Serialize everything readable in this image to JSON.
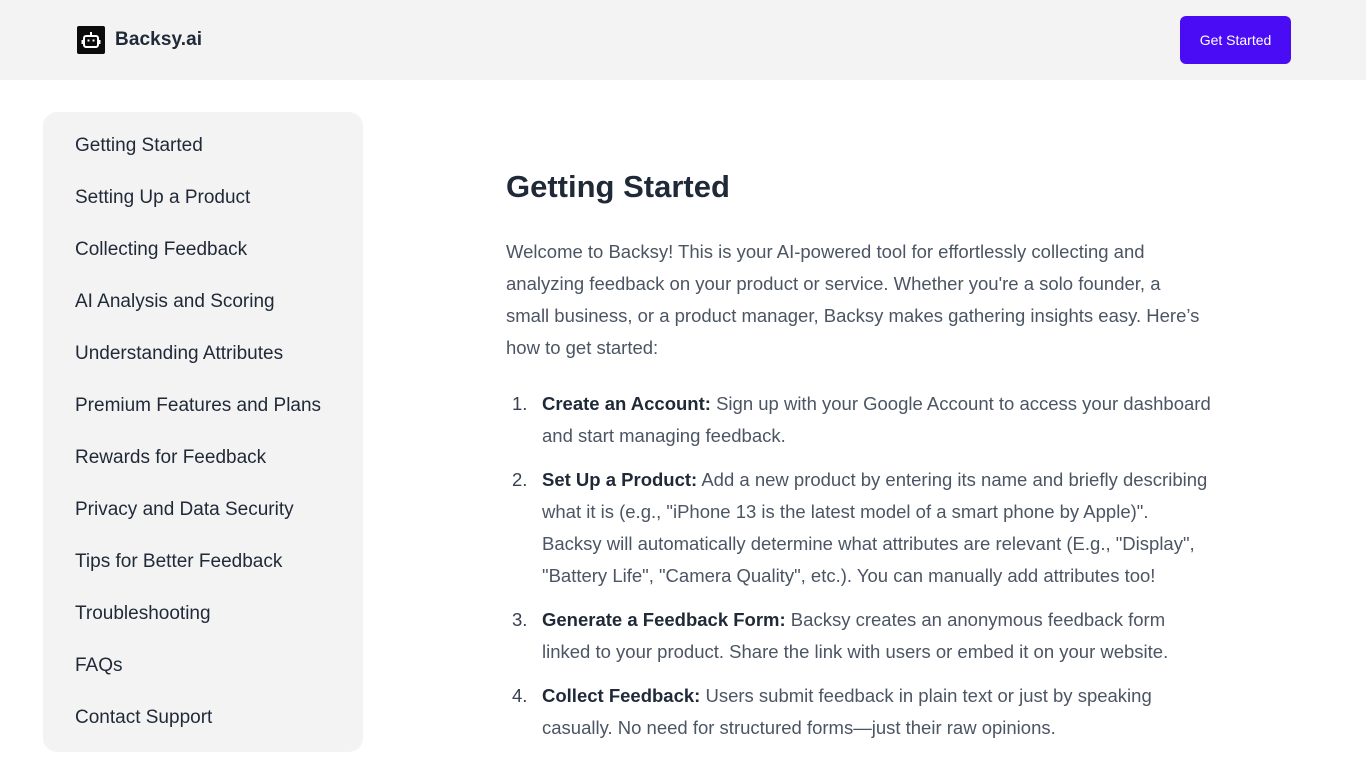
{
  "header": {
    "brand": "Backsy.ai",
    "logo_icon": "robot-icon",
    "cta_label": "Get Started"
  },
  "sidebar": {
    "items": [
      {
        "label": "Getting Started"
      },
      {
        "label": "Setting Up a Product"
      },
      {
        "label": "Collecting Feedback"
      },
      {
        "label": "AI Analysis and Scoring"
      },
      {
        "label": "Understanding Attributes"
      },
      {
        "label": "Premium Features and Plans"
      },
      {
        "label": "Rewards for Feedback"
      },
      {
        "label": "Privacy and Data Security"
      },
      {
        "label": "Tips for Better Feedback"
      },
      {
        "label": "Troubleshooting"
      },
      {
        "label": "FAQs"
      },
      {
        "label": "Contact Support"
      }
    ]
  },
  "main": {
    "title": "Getting Started",
    "intro": "Welcome to Backsy! This is your AI-powered tool for effortlessly collecting and analyzing feedback on your product or service. Whether you're a solo founder, a small business, or a product manager, Backsy makes gathering insights easy. Here’s how to get started:",
    "steps": [
      {
        "number": "1.",
        "title": "Create an Account:",
        "text": " Sign up with your Google Account to access your dashboard and start managing feedback."
      },
      {
        "number": "2.",
        "title": "Set Up a Product:",
        "text": " Add a new product by entering its name and briefly describing what it is (e.g., \"iPhone 13 is the latest model of a smart phone by Apple)\". Backsy will automatically determine what attributes are relevant (E.g., \"Display\", \"Battery Life\", \"Camera Quality\", etc.). You can manually add attributes too!"
      },
      {
        "number": "3.",
        "title": "Generate a Feedback Form:",
        "text": " Backsy creates an anonymous feedback form linked to your product. Share the link with users or embed it on your website."
      },
      {
        "number": "4.",
        "title": "Collect Feedback:",
        "text": " Users submit feedback in plain text or just by speaking casually. No need for structured forms—just their raw opinions."
      }
    ]
  },
  "colors": {
    "accent": "#4a0cf5",
    "header_bg": "#f3f3f3",
    "sidebar_bg": "#f3f3f3",
    "text_dark": "#1f2937",
    "text_body": "#4b5563"
  }
}
